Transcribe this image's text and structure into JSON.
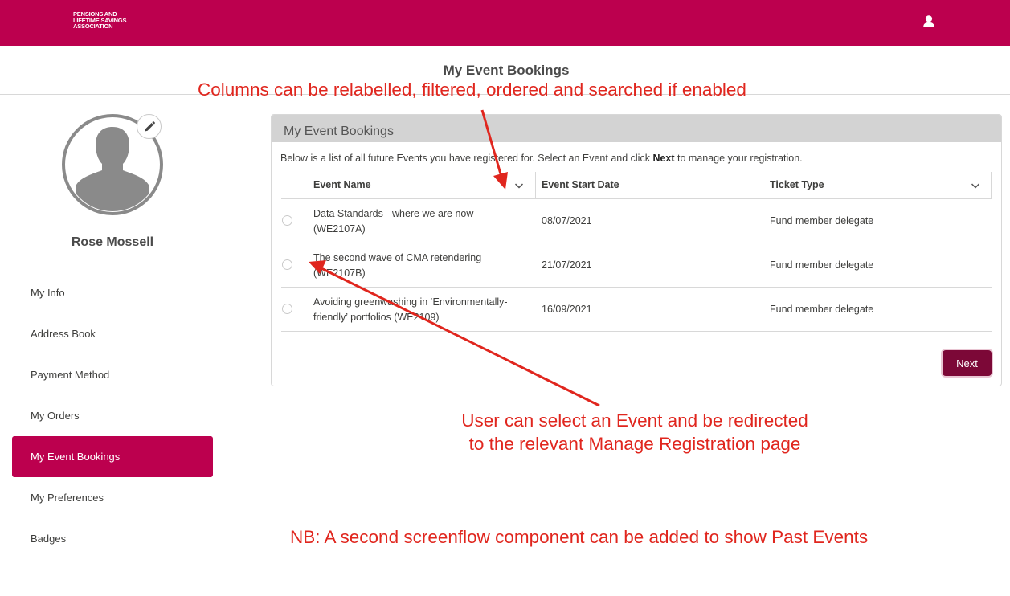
{
  "header": {
    "logo_lines": [
      "PENSIONS AND",
      "LIFETIME SAVINGS",
      "ASSOCIATION"
    ],
    "user_icon": "user-icon",
    "brand_color": "#bc004e"
  },
  "page": {
    "title": "My Event Bookings"
  },
  "profile": {
    "name": "Rose Mossell",
    "edit_icon": "pencil-icon"
  },
  "sidebar": {
    "items": [
      {
        "label": "My Info",
        "active": false
      },
      {
        "label": "Address Book",
        "active": false
      },
      {
        "label": "Payment Method",
        "active": false
      },
      {
        "label": "My Orders",
        "active": false
      },
      {
        "label": "My Event Bookings",
        "active": true
      },
      {
        "label": "My Preferences",
        "active": false
      },
      {
        "label": "Badges",
        "active": false
      }
    ]
  },
  "bookings": {
    "card_title": "My Event Bookings",
    "description_before": "Below is a list of all future Events you have registered for. Select an Event and click ",
    "description_bold": "Next",
    "description_after": " to manage your registration.",
    "columns": [
      {
        "label": "Event Name",
        "has_dropdown": true
      },
      {
        "label": "Event Start Date",
        "has_dropdown": false
      },
      {
        "label": "Ticket Type",
        "has_dropdown": true
      }
    ],
    "rows": [
      {
        "name_line1": "Data Standards - where we are now",
        "name_line2": "(WE2107A)",
        "start_date": "08/07/2021",
        "ticket_type": "Fund member delegate",
        "selected": false
      },
      {
        "name_line1": "The second wave of CMA retendering",
        "name_line2": "(WE2107B)",
        "start_date": "21/07/2021",
        "ticket_type": "Fund member delegate",
        "selected": false
      },
      {
        "name_line1": "Avoiding greenwashing in ‘Environmentally-",
        "name_line2": "friendly’ portfolios (WE2109)",
        "start_date": "16/09/2021",
        "ticket_type": "Fund member delegate",
        "selected": false
      }
    ],
    "next_label": "Next"
  },
  "annotations": {
    "columns_note": "Columns can be relabelled, filtered, ordered and searched if enabled",
    "select_note_line1": "User can select an Event and be redirected",
    "select_note_line2": "to the relevant Manage Registration page",
    "nb_note": "NB: A second screenflow component can be added to show Past Events",
    "color": "#e0261e"
  }
}
